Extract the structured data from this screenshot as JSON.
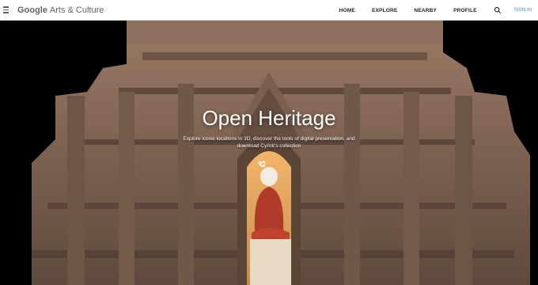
{
  "header": {
    "logo_g": "Google",
    "logo_rest": "Arts & Culture",
    "nav": [
      "HOME",
      "EXPLORE",
      "NEARBY",
      "PROFILE"
    ],
    "signin": "SIGN IN"
  },
  "hero": {
    "title": "Open Heritage",
    "subtitle": "Explore iconic locations in 3D, discover the tools of digital preservation, and download CyArk's collection"
  },
  "icons": {
    "menu": "hamburger-menu-icon",
    "search": "search-icon",
    "favorite": "heart-icon",
    "share": "share-icon"
  }
}
